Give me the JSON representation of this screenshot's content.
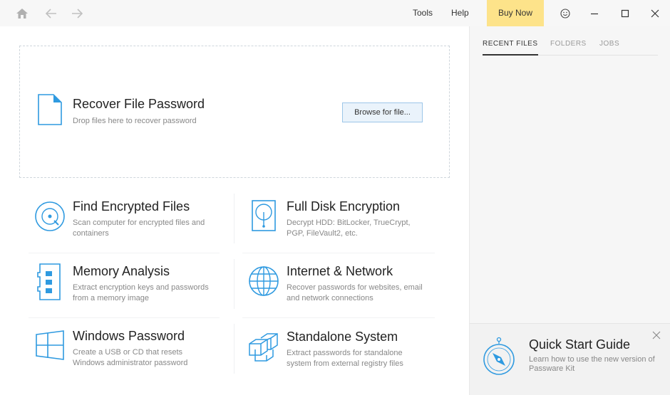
{
  "titlebar": {
    "tools_label": "Tools",
    "help_label": "Help",
    "buy_now_label": "Buy Now"
  },
  "dropzone": {
    "title": "Recover File Password",
    "subtitle": "Drop files here to recover password",
    "browse_label": "Browse for file..."
  },
  "tiles": [
    {
      "title": "Find Encrypted Files",
      "desc": "Scan computer for encrypted files and containers",
      "icon": "disc-search-icon"
    },
    {
      "title": "Full Disk Encryption",
      "desc": "Decrypt HDD: BitLocker, TrueCrypt, PGP, FileVault2, etc.",
      "icon": "disk-drive-icon"
    },
    {
      "title": "Memory Analysis",
      "desc": "Extract encryption keys and passwords from a memory image",
      "icon": "memory-module-icon"
    },
    {
      "title": "Internet & Network",
      "desc": "Recover passwords for websites, email and network connections",
      "icon": "globe-icon"
    },
    {
      "title": "Windows Password",
      "desc": "Create a USB or CD that resets Windows administrator password",
      "icon": "windows-logo-icon"
    },
    {
      "title": "Standalone System",
      "desc": "Extract passwords for standalone system from external registry files",
      "icon": "cubes-icon"
    }
  ],
  "right_panel": {
    "tabs": [
      {
        "label": "RECENT FILES",
        "active": true
      },
      {
        "label": "FOLDERS",
        "active": false
      },
      {
        "label": "JOBS",
        "active": false
      }
    ],
    "quick_start": {
      "title": "Quick Start Guide",
      "desc": "Learn how to use the new version of Passware Kit"
    }
  },
  "colors": {
    "accent_blue": "#2f9ae0",
    "buy_now_bg": "#fde38a",
    "panel_bg": "#f6f6f6"
  }
}
